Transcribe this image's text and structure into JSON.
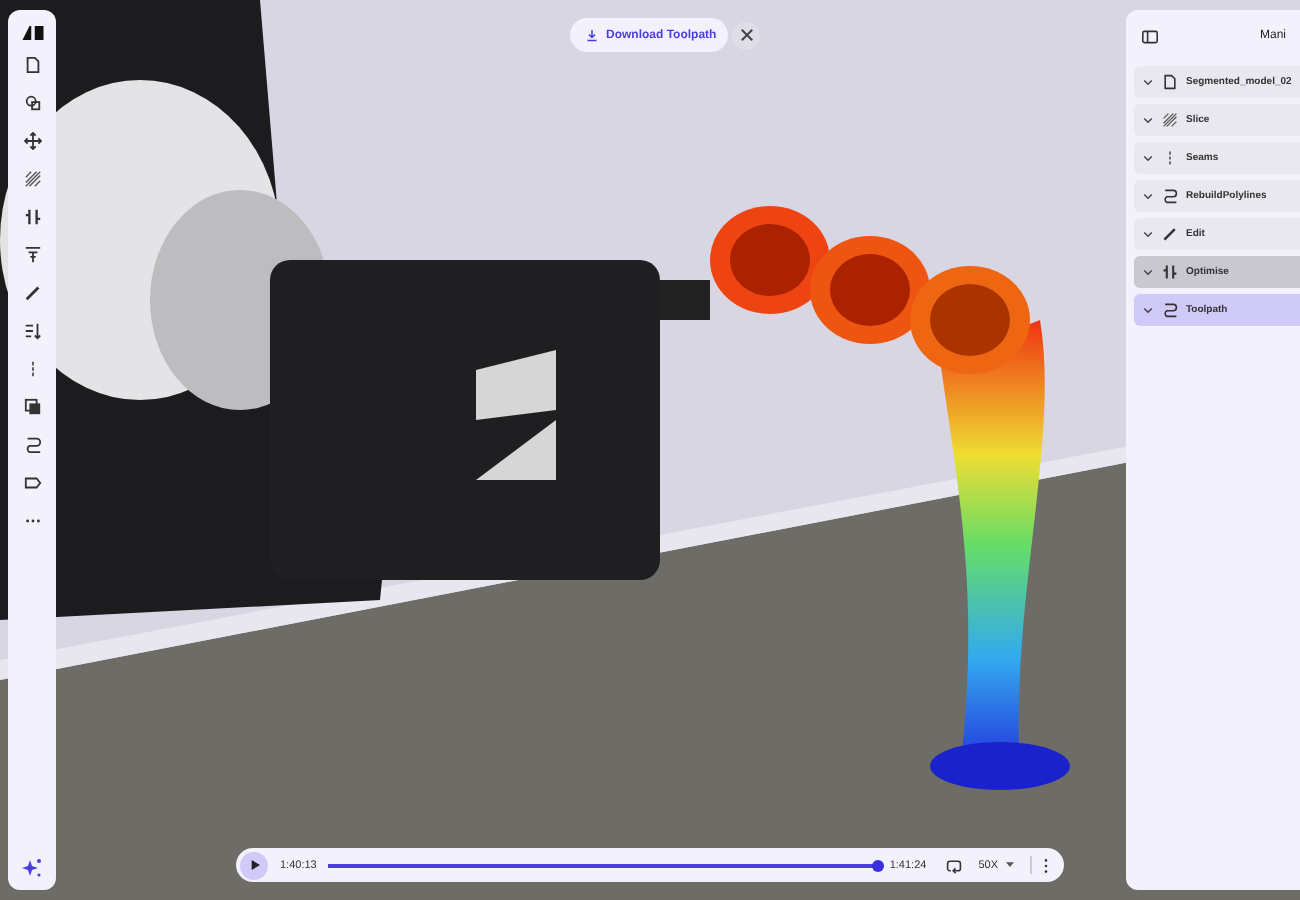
{
  "toolbar": {
    "items": [
      {
        "kind": "file"
      },
      {
        "kind": "shapes"
      },
      {
        "kind": "move"
      },
      {
        "kind": "hatch"
      },
      {
        "kind": "split"
      },
      {
        "kind": "filter"
      },
      {
        "kind": "pen"
      },
      {
        "kind": "sort"
      },
      {
        "kind": "seam"
      },
      {
        "kind": "layers"
      },
      {
        "kind": "path"
      },
      {
        "kind": "tag"
      },
      {
        "kind": "more"
      }
    ]
  },
  "download": {
    "label": "Download Toolpath"
  },
  "panel": {
    "title": "Mani",
    "items": [
      {
        "label": "Segmented_model_02",
        "kind": "file",
        "selected": false,
        "hovered": false
      },
      {
        "label": "Slice",
        "kind": "hatch",
        "selected": false,
        "hovered": false
      },
      {
        "label": "Seams",
        "kind": "seam",
        "selected": false,
        "hovered": false
      },
      {
        "label": "RebuildPolylines",
        "kind": "path",
        "selected": false,
        "hovered": false
      },
      {
        "label": "Edit",
        "kind": "pen",
        "selected": false,
        "hovered": false
      },
      {
        "label": "Optimise",
        "kind": "split",
        "selected": false,
        "hovered": true
      },
      {
        "label": "Toolpath",
        "kind": "path",
        "selected": true,
        "hovered": false
      }
    ]
  },
  "player": {
    "elapsed": "1:40:13",
    "level": 1,
    "total": "1:41:24",
    "speed": "50X"
  }
}
